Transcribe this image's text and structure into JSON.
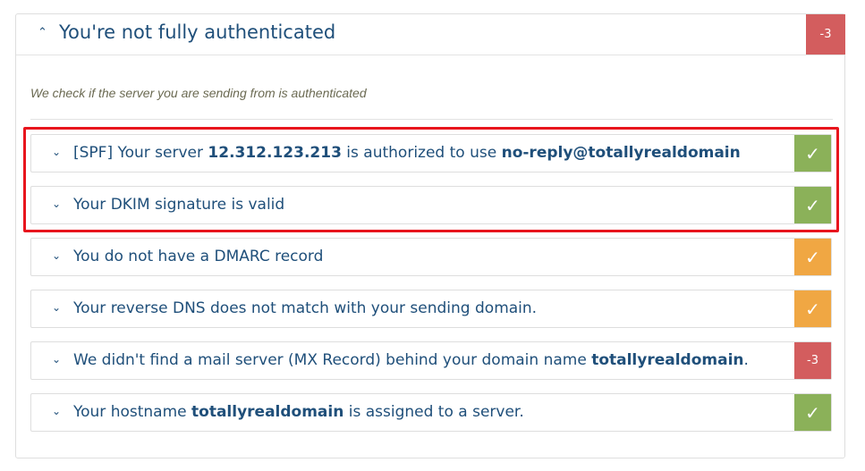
{
  "section": {
    "title": "You're not fully authenticated",
    "score": "-3",
    "description": "We check if the server you are sending from is authenticated"
  },
  "checks": [
    {
      "parts": [
        "[SPF] Your server ",
        "12.312.123.213",
        " is authorized to use ",
        "no-reply@totallyrealdomain",
        ""
      ],
      "status": "pass",
      "badge": "✓"
    },
    {
      "parts": [
        "Your DKIM signature is valid",
        "",
        "",
        "",
        ""
      ],
      "status": "pass",
      "badge": "✓"
    },
    {
      "parts": [
        "You do not have a DMARC record",
        "",
        "",
        "",
        ""
      ],
      "status": "warning",
      "badge": "✓"
    },
    {
      "parts": [
        "Your reverse DNS does not match with your sending domain.",
        "",
        "",
        "",
        ""
      ],
      "status": "warning",
      "badge": "✓"
    },
    {
      "parts": [
        "We didn't find a mail server (MX Record) behind your domain name ",
        "totallyrealdomain",
        ".",
        "",
        ""
      ],
      "status": "fail",
      "badge": "-3"
    },
    {
      "parts": [
        "Your hostname ",
        "totallyrealdomain",
        " is assigned to a server.",
        "",
        ""
      ],
      "status": "pass",
      "badge": "✓"
    }
  ],
  "icons": {
    "collapse": "chevron-up-icon",
    "expand": "chevron-down-icon",
    "check": "check-icon"
  },
  "colors": {
    "pass": "#8bb159",
    "warning": "#f0a743",
    "fail": "#d35d5e",
    "highlight": "#e8151d",
    "text": "#1f4f7a"
  }
}
